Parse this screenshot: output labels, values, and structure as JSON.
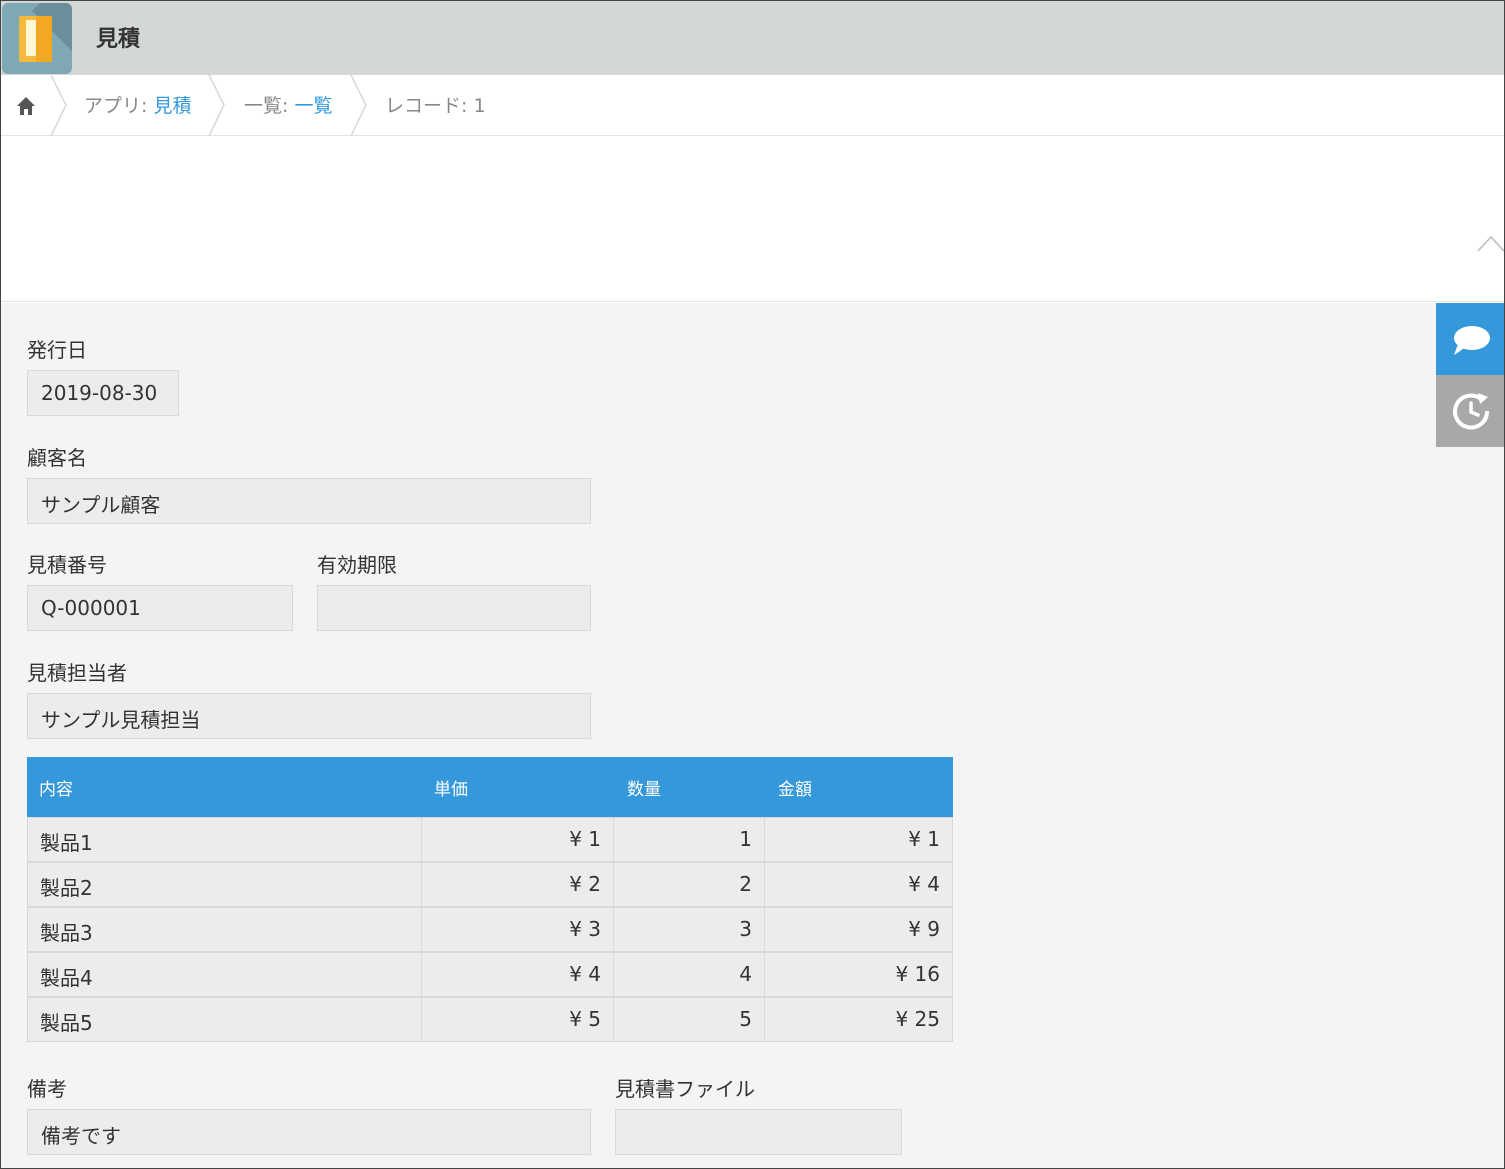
{
  "header": {
    "title": "見積",
    "app_icon": "book-icon"
  },
  "breadcrumb": {
    "home_icon": "home-icon",
    "app_prefix": "アプリ: ",
    "app_link": "見積",
    "view_prefix": "一覧: ",
    "view_link": "一覧",
    "record": "レコード: 1"
  },
  "side_buttons": {
    "comment_icon": "speech-bubble-icon",
    "history_icon": "history-clock-icon"
  },
  "fields": {
    "issue_date": {
      "label": "発行日",
      "value": "2019-08-30"
    },
    "customer": {
      "label": "顧客名",
      "value": "サンプル顧客"
    },
    "quote_number": {
      "label": "見積番号",
      "value": "Q-000001"
    },
    "valid_until": {
      "label": "有効期限",
      "value": ""
    },
    "person": {
      "label": "見積担当者",
      "value": "サンプル見積担当"
    },
    "notes": {
      "label": "備考",
      "value": "備考です"
    },
    "quote_file": {
      "label": "見積書ファイル",
      "value": ""
    }
  },
  "table": {
    "headers": [
      "内容",
      "単価",
      "数量",
      "金額"
    ],
    "rows": [
      [
        "製品1",
        "¥ 1",
        "1",
        "¥ 1"
      ],
      [
        "製品2",
        "¥ 2",
        "2",
        "¥ 4"
      ],
      [
        "製品3",
        "¥ 3",
        "3",
        "¥ 9"
      ],
      [
        "製品4",
        "¥ 4",
        "4",
        "¥ 16"
      ],
      [
        "製品5",
        "¥ 5",
        "5",
        "¥ 25"
      ]
    ]
  },
  "colors": {
    "accent": "#3498db",
    "header_bg": "#d4d7d8",
    "record_bg": "#f4f4f4"
  }
}
